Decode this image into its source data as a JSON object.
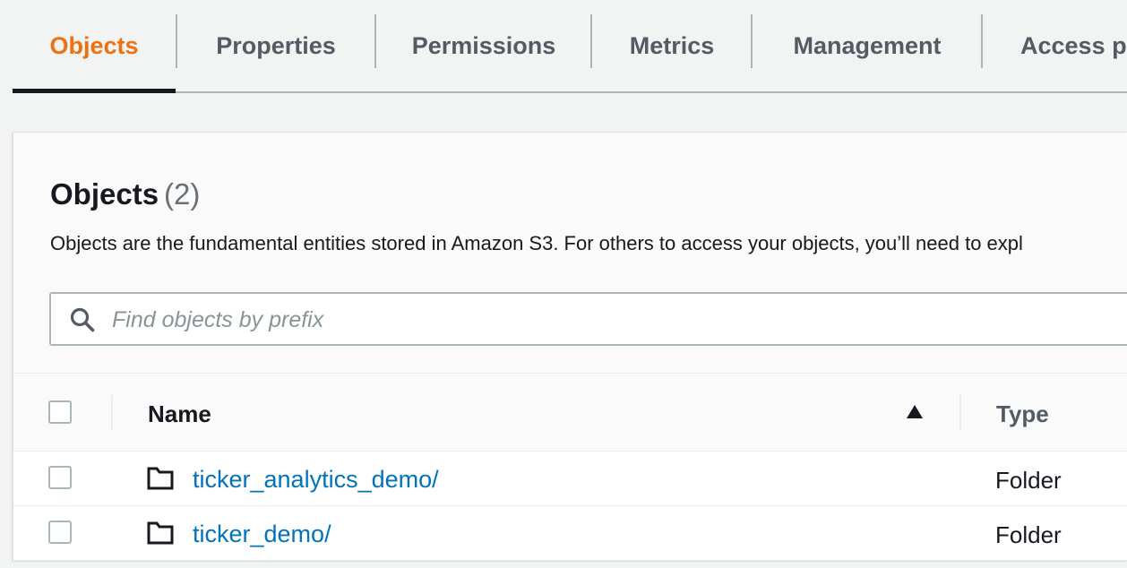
{
  "tabs": [
    {
      "label": "Objects",
      "active": true
    },
    {
      "label": "Properties",
      "active": false
    },
    {
      "label": "Permissions",
      "active": false
    },
    {
      "label": "Metrics",
      "active": false
    },
    {
      "label": "Management",
      "active": false
    },
    {
      "label": "Access po",
      "active": false
    }
  ],
  "objects_panel": {
    "title": "Objects",
    "count": "(2)",
    "description": "Objects are the fundamental entities stored in Amazon S3. For others to access your objects, you’ll need to expl",
    "search": {
      "placeholder": "Find objects by prefix",
      "value": "",
      "icon": "search-icon"
    },
    "table": {
      "columns": [
        {
          "label": "Name",
          "sort": "ascending",
          "sort_icon": "sort-ascending-icon"
        },
        {
          "label": "Type"
        }
      ],
      "rows": [
        {
          "name": "ticker_analytics_demo/",
          "type": "Folder",
          "icon": "folder-icon"
        },
        {
          "name": "ticker_demo/",
          "type": "Folder",
          "icon": "folder-icon"
        }
      ]
    }
  },
  "colors": {
    "accent": "#ec7211",
    "link": "#0073bb",
    "text": "#16191f",
    "muted": "#545b64",
    "border": "#aab7b8",
    "background": "#f2f3f3"
  }
}
